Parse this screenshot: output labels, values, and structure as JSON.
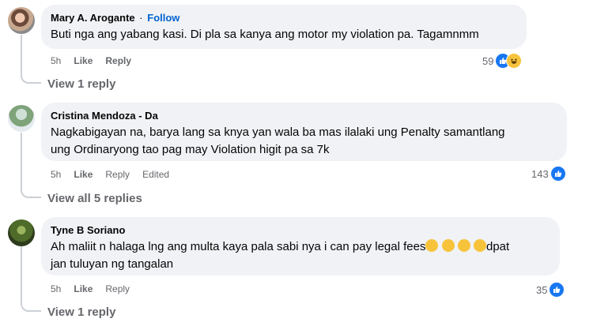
{
  "comments": [
    {
      "author": "Mary A. Arogante",
      "follow_label": "Follow",
      "separator": "·",
      "text": "Buti nga ang yabang kasi. Di pla sa kanya ang motor my violation pa. Tagamnmm",
      "time": "5h",
      "like_label": "Like",
      "reply_label": "Reply",
      "reaction_count": "59",
      "reaction_icons": [
        "like-icon",
        "haha-icon"
      ],
      "replies_label": "View 1 reply"
    },
    {
      "author": "Cristina Mendoza - Da",
      "text_line1": "Nagkabigayan na, barya lang sa knya yan wala ba mas ilalaki ung Penalty samantlang",
      "text_line2": "ung Ordinaryong tao pag may Violation higit pa sa 7k",
      "time": "5h",
      "like_label": "Like",
      "reply_label": "Reply",
      "edited_label": "Edited",
      "reaction_count": "143",
      "reaction_icons": [
        "like-icon"
      ],
      "replies_label": "View all 5 replies"
    },
    {
      "author": "Tyne B Soriano",
      "text_line1_a": "Ah maliit n halaga lng ang multa kaya pala sabi nya i can pay legal fees",
      "text_line1_b": "dpat",
      "text_line2": "jan tuluyan ng tangalan",
      "time": "5h",
      "like_label": "Like",
      "reply_label": "Reply",
      "reaction_count": "35",
      "reaction_icons": [
        "like-icon"
      ],
      "replies_label": "View 1 reply"
    }
  ],
  "colors": {
    "bubble_bg": "#f0f2f5",
    "follow_link": "#0064d1",
    "meta_text": "#65676b",
    "like_blue": "#1877f2",
    "haha_yellow": "#f7c33b"
  }
}
